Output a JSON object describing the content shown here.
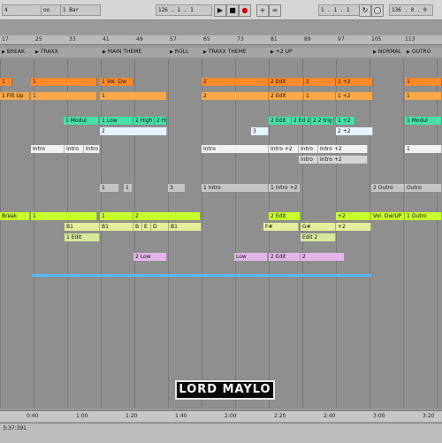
{
  "toolbar": {
    "signature": "4",
    "loop_icon": "oo",
    "quantize": "1 Bar",
    "tempo": "126 . 1 . 1",
    "position": "1 . 1 . 1",
    "length": "136 . 0 . 0"
  },
  "ruler": [
    "17",
    "25",
    "33",
    "41",
    "49",
    "57",
    "65",
    "73",
    "81",
    "89",
    "97",
    "105",
    "113"
  ],
  "markers": [
    "BREAK",
    "TRAXX",
    "MAIN THEME",
    "ROLL",
    "TRAXX THEME",
    "+2 UP",
    "NORMAL",
    "OUTRO"
  ],
  "lanes": [
    {
      "color": "#ff8a2a",
      "clips": [
        [
          "1",
          0,
          14
        ],
        [
          "1",
          35,
          75
        ],
        [
          "1 Vol. Dw",
          113,
          38
        ],
        [
          "2",
          228,
          76
        ],
        [
          "2 Edit",
          304,
          40
        ],
        [
          "2",
          344,
          36
        ],
        [
          "1 +2",
          380,
          42
        ],
        [
          "1",
          458,
          42
        ]
      ]
    },
    {
      "color": "#ffa84a",
      "clips": [
        [
          "1 Filt Up",
          0,
          34
        ],
        [
          "1",
          35,
          75
        ],
        [
          "1",
          113,
          76
        ],
        [
          "2",
          228,
          76
        ],
        [
          "2 Edit",
          304,
          40
        ],
        [
          "1",
          344,
          36
        ],
        [
          "1 +2",
          380,
          42
        ],
        [
          "1",
          458,
          42
        ]
      ]
    },
    {
      "color": "#44e0a8",
      "clips": [
        [
          "1 Modul",
          72,
          40
        ],
        [
          "1 Low",
          113,
          38
        ],
        [
          "2 High",
          151,
          24
        ],
        [
          "2 Hig",
          175,
          14
        ],
        [
          "2 Edit",
          304,
          26
        ],
        [
          "2 Ed 2",
          330,
          22
        ],
        [
          "2 2 trig",
          352,
          26
        ],
        [
          "1 +2",
          380,
          22
        ],
        [
          "1 Modul",
          458,
          42
        ]
      ]
    },
    {
      "color": "#e6f4ff",
      "clips": [
        [
          "2",
          113,
          76
        ],
        [
          "3",
          284,
          20
        ],
        [
          "2 +2",
          380,
          42
        ]
      ]
    },
    {
      "color": "#f0f0f0",
      "clips": [
        [
          "Intro",
          35,
          38
        ],
        [
          "Intro",
          73,
          22
        ],
        [
          "Intro",
          95,
          18
        ],
        [
          "Intro",
          228,
          76
        ],
        [
          "Intro +2",
          304,
          34
        ],
        [
          "Intro",
          338,
          22
        ],
        [
          "Intro +2",
          360,
          56
        ],
        [
          "1",
          458,
          42
        ]
      ]
    },
    {
      "color": "#d4d4d4",
      "clips": [
        [
          "Intro",
          338,
          22
        ],
        [
          "Intro +2",
          360,
          56
        ]
      ]
    },
    {
      "color": "#c4c4c4",
      "clips": [
        [
          "1",
          113,
          22
        ],
        [
          "1",
          140,
          10
        ],
        [
          "3",
          190,
          20
        ],
        [
          "1 Intro",
          228,
          76
        ],
        [
          "1 Intro +2",
          304,
          36
        ],
        [
          "2 Outro",
          420,
          38
        ],
        [
          "Outro",
          458,
          42
        ]
      ]
    },
    {
      "color": "#c7ff2a",
      "clips": [
        [
          "Break",
          0,
          34
        ],
        [
          "1",
          35,
          75
        ],
        [
          "1",
          113,
          38
        ],
        [
          "2",
          151,
          76
        ],
        [
          "2 Edit",
          304,
          36
        ],
        [
          "+2",
          380,
          40
        ],
        [
          "Vol. Dw/UP",
          420,
          38
        ],
        [
          "1 Outro",
          458,
          42
        ]
      ]
    },
    {
      "color": "#e6ee9c",
      "clips": [
        [
          "B1",
          73,
          40
        ],
        [
          "B1",
          113,
          38
        ],
        [
          "B",
          151,
          10
        ],
        [
          "E",
          161,
          10
        ],
        [
          "D",
          171,
          20
        ],
        [
          "B1",
          191,
          37
        ],
        [
          "F#",
          298,
          40
        ],
        [
          "G#",
          340,
          40
        ],
        [
          "+2",
          380,
          40
        ]
      ]
    },
    {
      "color": "#d6e89a",
      "clips": [
        [
          "1 Edit",
          73,
          40
        ],
        [
          "Edit 2",
          340,
          40
        ]
      ]
    },
    {
      "color": "#e2b6e6",
      "clips": [
        [
          "2 Low",
          151,
          38
        ],
        [
          "Low",
          265,
          38
        ],
        [
          "2 Edit",
          304,
          36
        ],
        [
          "2",
          340,
          50
        ]
      ]
    }
  ],
  "timeline": [
    "0:40",
    "1:00",
    "1:20",
    "1:40",
    "2:00",
    "2:20",
    "2:40",
    "3:00",
    "3:20"
  ],
  "status": "3:37:391",
  "logo": "LORD MAYLO",
  "colors": {
    "orange": "#ff8a2a",
    "green": "#c7ff2a",
    "teal": "#44e0a8",
    "purple": "#e2b6e6",
    "blue": "#55b8ff"
  }
}
